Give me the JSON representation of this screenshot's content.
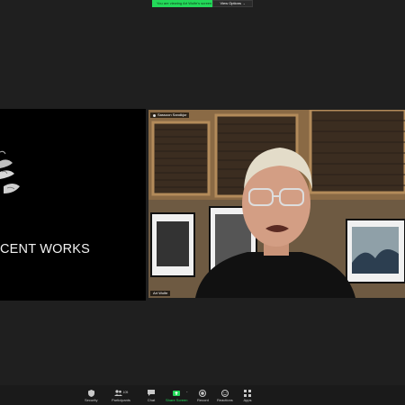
{
  "banner": {
    "share_status": "You are viewing Art Wolfe's screen",
    "view_options": "View Options",
    "view_options_caret": "⌄"
  },
  "shared_screen": {
    "text": "CENT WORKS"
  },
  "video": {
    "top_name": "Sassoon Sandkjor",
    "bottom_name": "Art Wolfe"
  },
  "toolbar": {
    "items": [
      {
        "label": "Security",
        "icon": "shield-icon"
      },
      {
        "label": "Participants",
        "count": "105",
        "icon": "participants-icon"
      },
      {
        "label": "Chat",
        "icon": "chat-icon"
      },
      {
        "label": "Share Screen",
        "icon": "share-screen-icon"
      },
      {
        "label": "Record",
        "icon": "record-icon"
      },
      {
        "label": "Reactions",
        "icon": "reactions-icon"
      },
      {
        "label": "Apps",
        "icon": "apps-icon"
      }
    ],
    "caret": "^"
  },
  "colors": {
    "background": "#1f1f1f",
    "accent_green": "#23d959",
    "toolbar_bg": "#1a1a1a"
  }
}
